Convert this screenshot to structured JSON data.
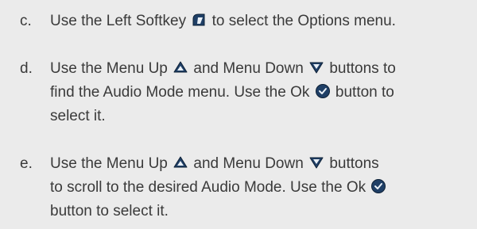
{
  "steps": [
    {
      "marker": "c.",
      "lines": [
        [
          "Use the Left Softkey",
          "softkey-icon",
          "to select the Options menu."
        ]
      ]
    },
    {
      "marker": "d.",
      "lines": [
        [
          "Use the Menu Up",
          "menu-up-icon",
          "and Menu Down",
          "menu-down-icon",
          "buttons to"
        ],
        [
          "find the Audio Mode menu. Use the Ok",
          "ok-icon",
          "button to"
        ],
        [
          "select it."
        ]
      ]
    },
    {
      "marker": "e.",
      "lines": [
        [
          "Use the Menu Up",
          "menu-up-icon",
          "and Menu Down",
          "menu-down-icon",
          "buttons"
        ],
        [
          "to scroll to the desired Audio Mode. Use the Ok",
          "ok-icon"
        ],
        [
          "button to select it."
        ]
      ]
    }
  ],
  "icons": {
    "softkey": "softkey-icon",
    "menu_up": "menu-up-icon",
    "menu_down": "menu-down-icon",
    "ok": "ok-icon"
  },
  "colors": {
    "background": "#ebebeb",
    "text": "#3a3a3a",
    "icon_fill": "#1f3f66",
    "icon_stroke": "#0d2036"
  }
}
